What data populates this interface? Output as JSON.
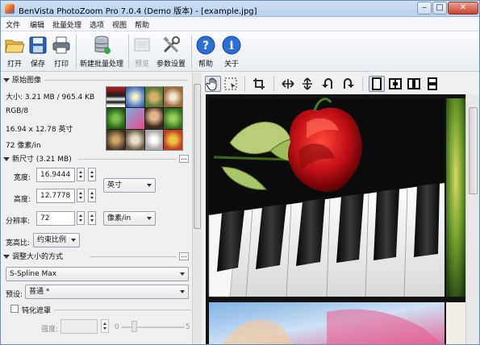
{
  "window": {
    "title": "BenVista PhotoZoom Pro 7.0.4 (Demo 版本) - [example.jpg]",
    "min": "‒",
    "max": "□",
    "close": "✕"
  },
  "menu": [
    "文件",
    "编辑",
    "批量处理",
    "选项",
    "视图",
    "帮助"
  ],
  "toolbar": {
    "open": "打开",
    "save": "保存",
    "print": "打印",
    "new_batch": "新建批量处理",
    "preview": "预览",
    "settings": "参数设置",
    "help": "帮助",
    "about": "关于"
  },
  "original": {
    "header": "原始图像",
    "size": "大小: 3.21 MB / 965.4 KB",
    "mode": "RGB/8",
    "dimensions": "16.94 x 12.78 英寸",
    "resolution": "72 像素/in"
  },
  "new_size": {
    "header": "新尺寸 (3.21 MB)",
    "width_label": "宽度:",
    "width_value": "16.9444",
    "height_label": "高度:",
    "height_value": "12.7778",
    "unit": "英寸",
    "res_label": "分辨率:",
    "res_value": "72",
    "res_unit": "像素/in",
    "aspect_label": "宽高比:",
    "aspect_value": "约束比例"
  },
  "resize": {
    "header": "调整大小的方式",
    "method": "S-Spline Max",
    "preset_label": "预设:",
    "preset_value": "普通 *"
  },
  "sharpen": {
    "label": "钝化遮罩",
    "strength_label": "强度:",
    "min": "0",
    "max": "5"
  },
  "more_label": "...",
  "colors": {
    "title_bar": "#c5d9f0",
    "accent": "#2a6fd1",
    "close": "#c8432b"
  }
}
